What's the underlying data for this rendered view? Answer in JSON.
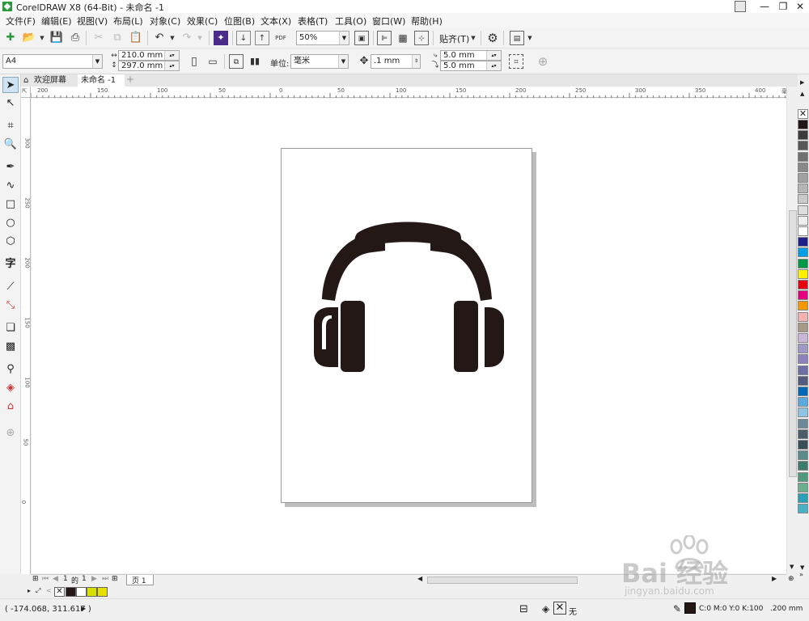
{
  "window": {
    "title": "CorelDRAW X8 (64-Bit) - 未命名 -1",
    "minimize": "—",
    "restore": "❐",
    "close": "✕"
  },
  "menu": [
    "文件(F)",
    "编辑(E)",
    "视图(V)",
    "布局(L)",
    "对象(C)",
    "效果(C)",
    "位图(B)",
    "文本(X)",
    "表格(T)",
    "工具(O)",
    "窗口(W)",
    "帮助(H)"
  ],
  "toolbar1": {
    "zoom_value": "50%",
    "snap_label": "贴齐(T)",
    "pdf_label": "PDF"
  },
  "toolbar2": {
    "paper_size": "A4",
    "width": "210.0 mm",
    "height": "297.0 mm",
    "units_label": "单位:",
    "units_value": "毫米",
    "nudge": ".1 mm",
    "dup_x": "5.0 mm",
    "dup_y": "5.0 mm"
  },
  "tabs": {
    "welcome": "欢迎屏幕",
    "document": "未命名 -1",
    "add": "+"
  },
  "rulers": {
    "h_ticks": [
      "200",
      "150",
      "100",
      "50",
      "0",
      "50",
      "100",
      "150",
      "200",
      "250",
      "300",
      "350",
      "400"
    ],
    "h_unit": "毫米",
    "v_ticks": [
      "300",
      "250",
      "200",
      "150",
      "100",
      "50",
      "0"
    ]
  },
  "pagenav": {
    "current": "1",
    "of": "的",
    "total": "1",
    "page_tab": "页 1"
  },
  "status": {
    "coords": "( -174.068, 311.617 )",
    "fill_none": "无",
    "outline_color": "C:0 M:0 Y:0 K:100",
    "outline_width": ".200 mm"
  },
  "palette_colors": [
    "#231815",
    "#3e3a39",
    "#595757",
    "#727171",
    "#898989",
    "#9fa0a0",
    "#b5b5b6",
    "#c9caca",
    "#dcdddd",
    "#efefef",
    "#ffffff",
    "#1d2088",
    "#00a0e9",
    "#009944",
    "#fff100",
    "#e60012",
    "#e4007f",
    "#f39800",
    "#f5b2b2",
    "#a69b89",
    "#c9b6d8",
    "#9e9ac8",
    "#8f82bc",
    "#6f6fa8",
    "#535a7f",
    "#0068b7",
    "#5ca9dd",
    "#8fc3e4",
    "#6a8a9a",
    "#4a5e6a",
    "#3a4e58",
    "#5a8a8a",
    "#3e7a6e",
    "#4e9a7a",
    "#6cae8e",
    "#2aa0b8",
    "#4ab0c8"
  ],
  "docpal_colors": [
    "#231815",
    "#ffffff",
    "#d8e000",
    "#e8e000"
  ],
  "watermark": {
    "text": "Bai 经验",
    "url": "jingyan.baidu.com"
  }
}
